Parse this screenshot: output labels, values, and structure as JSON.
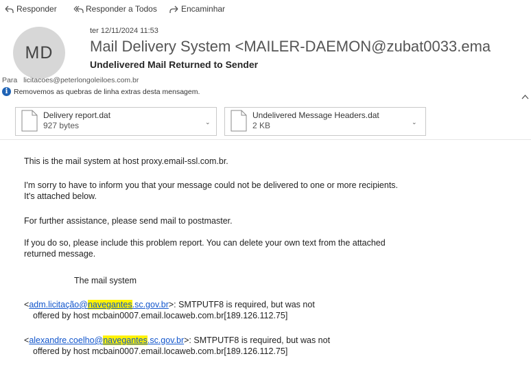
{
  "toolbar": {
    "reply": "Responder",
    "reply_all": "Responder a Todos",
    "forward": "Encaminhar"
  },
  "header": {
    "avatar_initials": "MD",
    "date": "ter 12/11/2024 11:53",
    "sender": "Mail Delivery System <MAILER-DAEMON@zubat0033.ema",
    "subject": "Undelivered Mail Returned to Sender",
    "to_label": "Para",
    "to_address": "licitacoes@peterlongoleiloes.com.br",
    "info_message": "Removemos as quebras de linha extras desta mensagem."
  },
  "attachments": [
    {
      "name": "Delivery report.dat",
      "size": "927 bytes"
    },
    {
      "name": "Undelivered Message Headers.dat",
      "size": "2 KB"
    }
  ],
  "body": {
    "p1": "This is the mail system at host proxy.email-ssl.com.br.",
    "p2_line1": "I'm sorry to have to inform you that your message could not be delivered to one or more recipients.",
    "p2_line2": "It's attached below.",
    "p3": "For further assistance, please send mail to postmaster.",
    "p4_line1": "If you do so, please include this problem report. You can delete your own text from the attached",
    "p4_line2": "returned message.",
    "signature": "The mail system",
    "recipients": [
      {
        "open": "<",
        "local": "adm.licitação@",
        "domain_hl": "navegantes",
        "domain_rest": ".sc.gov.br",
        "msg": ">: SMTPUTF8 is required, but was not",
        "line2": "offered by host mcbain0007.email.locaweb.com.br[189.126.112.75]"
      },
      {
        "open": "<",
        "local": "alexandre.coelho@",
        "domain_hl": "navegantes",
        "domain_rest": ".sc.gov.br",
        "msg": ">: SMTPUTF8 is required, but was not",
        "line2": "offered by host mcbain0007.email.locaweb.com.br[189.126.112.75]"
      }
    ]
  },
  "colors": {
    "link": "#1155cc",
    "highlight": "#fff200",
    "info_icon": "#1f63b5",
    "avatar_bg": "#d7d7d7"
  }
}
